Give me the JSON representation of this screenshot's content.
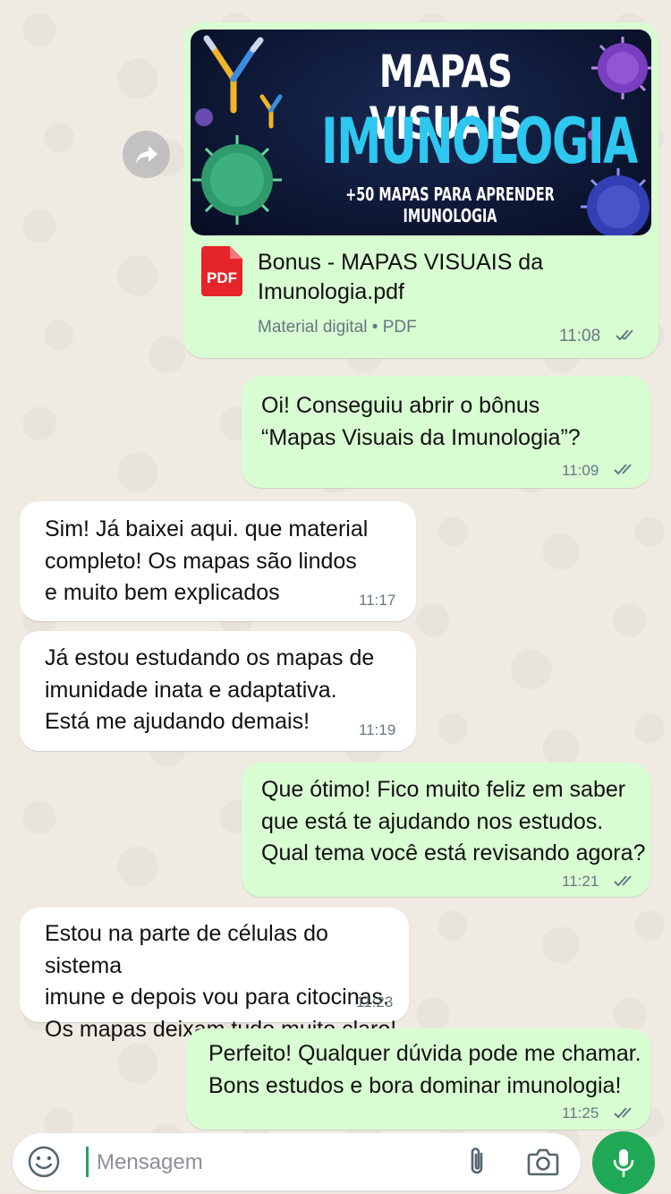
{
  "document_message": {
    "banner": {
      "title_line1": "MAPAS VISUAIS",
      "title_line2": "IMUNOLOGIA",
      "subtitle": "+50 MAPAS PARA APRENDER IMUNOLOGIA"
    },
    "file_type_label": "PDF",
    "file_name": "Bonus - MAPAS VISUAIS da Imunologia.pdf",
    "meta": "Material digital • PDF",
    "time": "11:08",
    "status": "read"
  },
  "messages": [
    {
      "direction": "out",
      "lines": [
        "Oi! Conseguiu abrir o bônus",
        "“Mapas Visuais da Imunologia”?"
      ],
      "time": "11:09",
      "status": "read"
    },
    {
      "direction": "in",
      "lines": [
        "Sim! Já baixei aqui. que material",
        "completo! Os mapas são lindos",
        "e muito bem explicados"
      ],
      "time": "11:17"
    },
    {
      "direction": "in",
      "lines": [
        "Já estou estudando os mapas de",
        "imunidade inata e adaptativa.",
        "Está me ajudando demais!"
      ],
      "time": "11:19"
    },
    {
      "direction": "out",
      "lines": [
        "Que ótimo! Fico muito feliz em saber",
        "que está te ajudando nos estudos.",
        "Qual tema você está revisando agora?"
      ],
      "time": "11:21",
      "status": "read"
    },
    {
      "direction": "in",
      "lines": [
        "Estou na parte de células do sistema",
        "imune e depois vou para citocinas.",
        "Os mapas deixam tudo muito claro!"
      ],
      "time": "11:23"
    },
    {
      "direction": "out",
      "lines": [
        "Perfeito! Qualquer dúvida pode me chamar.",
        "Bons estudos e bora dominar imunologia!"
      ],
      "time": "11:25",
      "status": "read"
    }
  ],
  "composer": {
    "placeholder": "Mensagem",
    "value": ""
  },
  "colors": {
    "outgoing_bubble": "#d9fdd3",
    "incoming_bubble": "#ffffff",
    "mic_button": "#1fa855",
    "banner_accent": "#2ec7f0",
    "pdf_red": "#e5252a"
  },
  "icons": [
    "forward-icon",
    "pdf-icon",
    "double-check-icon",
    "emoji-icon",
    "attach-icon",
    "camera-icon",
    "mic-icon"
  ]
}
